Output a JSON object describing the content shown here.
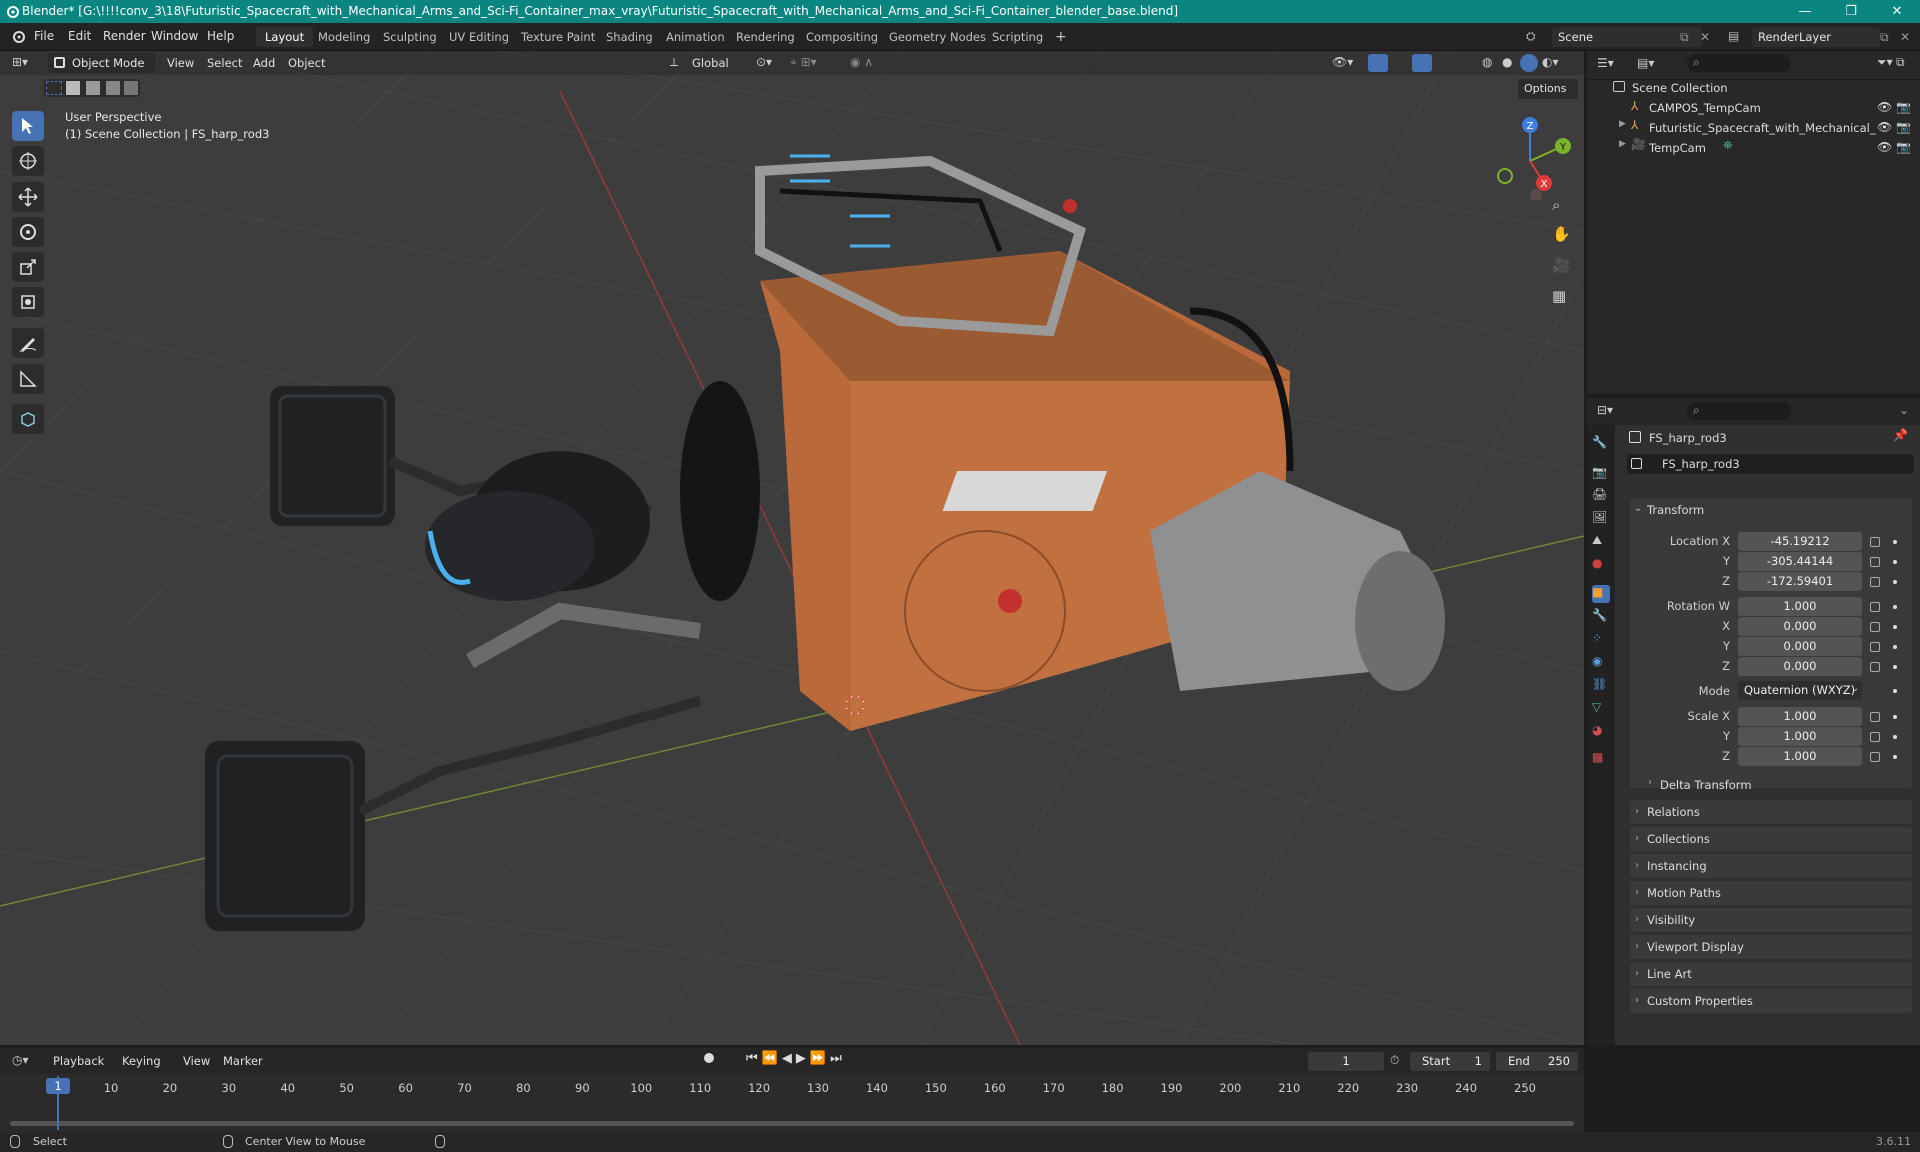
{
  "window": {
    "title": "Blender* [G:\\!!!!conv_3\\18\\Futuristic_Spacecraft_with_Mechanical_Arms_and_Sci-Fi_Container_max_vray\\Futuristic_Spacecraft_with_Mechanical_Arms_and_Sci-Fi_Container_blender_base.blend]"
  },
  "menu": {
    "file": "File",
    "edit": "Edit",
    "render": "Render",
    "window": "Window",
    "help": "Help"
  },
  "workspaces": [
    "Layout",
    "Modeling",
    "Sculpting",
    "UV Editing",
    "Texture Paint",
    "Shading",
    "Animation",
    "Rendering",
    "Compositing",
    "Geometry Nodes",
    "Scripting",
    "+"
  ],
  "scene": {
    "name": "Scene",
    "layer": "RenderLayer"
  },
  "viewport": {
    "mode": "Object Mode",
    "menus": [
      "View",
      "Select",
      "Add",
      "Object"
    ],
    "orientation": "Global",
    "options": "Options",
    "perspective": "User Perspective",
    "collection": "(1) Scene Collection | FS_harp_rod3",
    "gizmo": {
      "x": "X",
      "y": "Y",
      "z": "Z"
    }
  },
  "outliner": {
    "root": "Scene Collection",
    "items": [
      {
        "name": "CAMPOS_TempCam"
      },
      {
        "name": "Futuristic_Spacecraft_with_Mechanical_"
      },
      {
        "name": "TempCam"
      }
    ]
  },
  "properties": {
    "object_name": "FS_harp_rod3",
    "data_name": "FS_harp_rod3",
    "transform": "Transform",
    "location_label": "Location X",
    "location": [
      "-45.19212",
      "-305.44144",
      "-172.59401"
    ],
    "rotation_label": "Rotation W",
    "rotation": [
      "1.000",
      "0.000",
      "0.000",
      "0.000"
    ],
    "mode_label": "Mode",
    "mode": "Quaternion (WXYZ)",
    "scale_label": "Scale X",
    "scale": [
      "1.000",
      "1.000",
      "1.000"
    ],
    "axis": {
      "x": "X",
      "y": "Y",
      "z": "Z"
    },
    "delta": "Delta Transform",
    "panels": [
      "Relations",
      "Collections",
      "Instancing",
      "Motion Paths",
      "Visibility",
      "Viewport Display",
      "Line Art",
      "Custom Properties"
    ]
  },
  "timeline": {
    "menus": [
      "Playback",
      "Keying",
      "View",
      "Marker"
    ],
    "current": "1",
    "start_label": "Start",
    "start": "1",
    "end_label": "End",
    "end": "250",
    "ticks": [
      "1",
      "10",
      "20",
      "30",
      "40",
      "50",
      "60",
      "70",
      "80",
      "90",
      "100",
      "110",
      "120",
      "130",
      "140",
      "150",
      "160",
      "170",
      "180",
      "190",
      "200",
      "210",
      "220",
      "230",
      "240",
      "250"
    ],
    "playhead": "1"
  },
  "status": {
    "select": "Select",
    "center": "Center View to Mouse",
    "version": "3.6.11"
  },
  "colors": {
    "accent": "#4772b3",
    "titlebar": "#0a8580",
    "orange": "#b9693a"
  }
}
